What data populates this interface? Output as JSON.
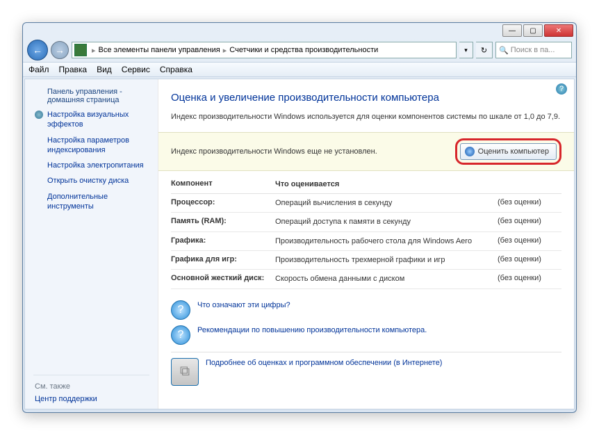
{
  "titlebar": {
    "min": "—",
    "max": "▢",
    "close": "✕"
  },
  "address": {
    "crumb1": "Все элементы панели управления",
    "crumb2": "Счетчики и средства производительности",
    "sep": "▸",
    "drop": "▾",
    "refresh": "↻"
  },
  "search": {
    "placeholder": "Поиск в па...",
    "icon": "🔍"
  },
  "menu": {
    "file": "Файл",
    "edit": "Правка",
    "view": "Вид",
    "tools": "Сервис",
    "help": "Справка"
  },
  "sidebar": {
    "home1": "Панель управления -",
    "home2": "домашняя страница",
    "items": [
      "Настройка визуальных эффектов",
      "Настройка параметров индексирования",
      "Настройка электропитания",
      "Открыть очистку диска",
      "Дополнительные инструменты"
    ],
    "see_also": "См. также",
    "support": "Центр поддержки"
  },
  "content": {
    "title": "Оценка и увеличение производительности компьютера",
    "intro": "Индекс производительности Windows используется для оценки компонентов системы по шкале от 1,0 до 7,9.",
    "warning": "Индекс производительности Windows еще не установлен.",
    "rate_btn": "Оценить компьютер",
    "head_component": "Компонент",
    "head_what": "Что оценивается",
    "no_rating": "(без оценки)",
    "rows": [
      {
        "c": "Процессор:",
        "w": "Операций вычисления в секунду"
      },
      {
        "c": "Память (RAM):",
        "w": "Операций доступа к памяти в секунду"
      },
      {
        "c": "Графика:",
        "w": "Производительность рабочего стола для Windows Aero"
      },
      {
        "c": "Графика для игр:",
        "w": "Производительность трехмерной графики и игр"
      },
      {
        "c": "Основной жесткий диск:",
        "w": "Скорость обмена данными с диском"
      }
    ],
    "link1": "Что означают эти цифры?",
    "link2": "Рекомендации по повышению производительности компьютера.",
    "link3": "Подробнее об оценках и программном обеспечении (в Интернете)"
  }
}
